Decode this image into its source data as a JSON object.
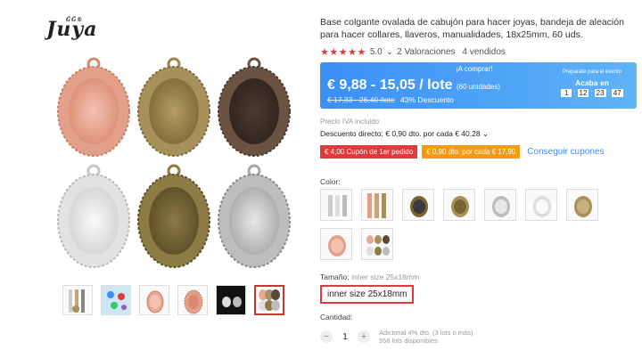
{
  "brand": {
    "logo_text": "Juya",
    "logo_small": "ḠḠ®"
  },
  "product": {
    "title": "Base colgante ovalada de cabujón para hacer joyas, bandeja de aleación para hacer collares, llaveros, manualidades, 18x25mm, 60 uds.",
    "rating_value": "5.0",
    "reviews": "2 Valoraciones",
    "sold": "4 vendidos"
  },
  "price_banner": {
    "sale_tag": "¡A comprar!",
    "price": "€ 9,88 - 15,05 / lote",
    "units": "(60 unidades)",
    "old_price": "€ 17,33 - 26,40 /lote",
    "discount": "43% Descuento",
    "countdown_label": "Preparate para el evento",
    "countdown_title": "Acaba en",
    "countdown": {
      "days": "1",
      "hours": "12",
      "minutes": "23",
      "seconds": "47"
    }
  },
  "vat_note": "Precio IVA incluido",
  "direct_discount": "Descuento directo: € 0,90 dto. por cada € 40,28 ⌄",
  "coupons": {
    "first_order": "€ 4,00 Cupón de 1er pedido",
    "per_amount": "€ 0,90 dto. por cada € 17,90",
    "get_link": "Conseguir cupones"
  },
  "color_label": "Color:",
  "size": {
    "label": "Tamaño:",
    "value": "inner size 25x18mm",
    "option": "inner size 25x18mm"
  },
  "quantity": {
    "label": "Cantidad:",
    "minus": "−",
    "value": "1",
    "plus": "+",
    "additional": "Adicional 4% dto. (3 lots o más)",
    "available": "556 lots disponibles"
  },
  "colors": {
    "rose_gold": "#e7a892",
    "bronze": "#a8905a",
    "dark_copper": "#5a4538",
    "silver": "#dcdcdc",
    "antique_bronze": "#8d7b45",
    "antique_silver": "#bdbdbd",
    "accent_red": "#e4393c",
    "accent_blue": "#3b8ff5"
  }
}
